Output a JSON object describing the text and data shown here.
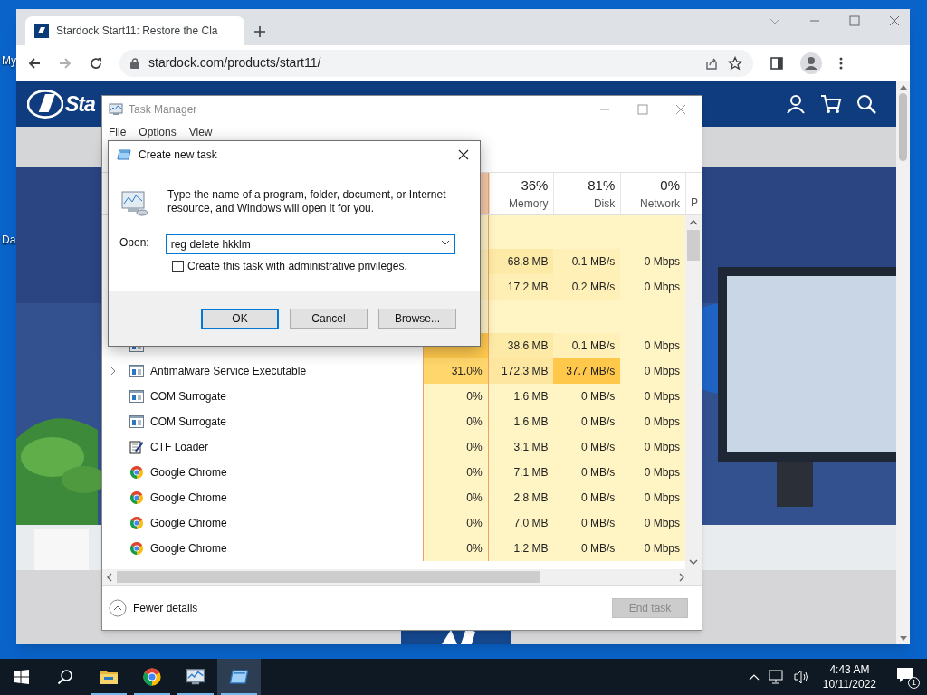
{
  "desktop": {
    "icon_labels": [
      "My",
      "Da"
    ]
  },
  "browser": {
    "tab": {
      "title": "Stardock Start11: Restore the Cla"
    },
    "address": "stardock.com/products/start11/",
    "page": {
      "logo_text": "Sta"
    }
  },
  "task_manager": {
    "title": "Task Manager",
    "menu": [
      "File",
      "Options",
      "View"
    ],
    "columns": [
      {
        "percent": "36%",
        "label": "Memory"
      },
      {
        "percent": "81%",
        "label": "Disk"
      },
      {
        "percent": "0%",
        "label": "Network"
      },
      {
        "label": "P"
      }
    ],
    "rows": [
      {
        "kind": "group"
      },
      {
        "kind": "process",
        "cells": [
          {
            "color": "#fff0b8"
          },
          {
            "text": "68.8 MB",
            "color": "#fdeaa6"
          },
          {
            "text": "0.1 MB/s",
            "color": "#fff0b8"
          },
          {
            "text": "0 Mbps",
            "color": "#fff4c4"
          }
        ]
      },
      {
        "kind": "process",
        "cells": [
          {
            "color": "#fff0b8"
          },
          {
            "text": "17.2 MB",
            "color": "#feefb4"
          },
          {
            "text": "0.2 MB/s",
            "color": "#fff0b8"
          },
          {
            "text": "0 Mbps",
            "color": "#fff4c4"
          }
        ]
      },
      {
        "kind": "group"
      },
      {
        "kind": "service",
        "expandable": false,
        "cells": [
          {
            "color": "#ffc94d"
          },
          {
            "text": "38.6 MB",
            "color": "#fdeaa6"
          },
          {
            "text": "0.1 MB/s",
            "color": "#fff0b8"
          },
          {
            "text": "0 Mbps",
            "color": "#fff4c4"
          }
        ]
      },
      {
        "kind": "service",
        "name": "Antimalware Service Executable",
        "expandable": true,
        "cells": [
          {
            "text": "31.0%",
            "color": "#ffd66b"
          },
          {
            "text": "172.3 MB",
            "color": "#fde6a0"
          },
          {
            "text": "37.7 MB/s",
            "color": "#ffc84a"
          },
          {
            "text": "0 Mbps",
            "color": "#fff4c4"
          }
        ]
      },
      {
        "kind": "service",
        "name": "COM Surrogate",
        "expandable": false,
        "cells": [
          {
            "text": "0%",
            "color": "#fff4c4"
          },
          {
            "text": "1.6 MB",
            "color": "#fff4c4"
          },
          {
            "text": "0 MB/s",
            "color": "#fff4c4"
          },
          {
            "text": "0 Mbps",
            "color": "#fff4c4"
          }
        ]
      },
      {
        "kind": "service",
        "name": "COM Surrogate",
        "expandable": false,
        "cells": [
          {
            "text": "0%",
            "color": "#fff4c4"
          },
          {
            "text": "1.6 MB",
            "color": "#fff4c4"
          },
          {
            "text": "0 MB/s",
            "color": "#fff4c4"
          },
          {
            "text": "0 Mbps",
            "color": "#fff4c4"
          }
        ]
      },
      {
        "kind": "loader",
        "name": "CTF Loader",
        "expandable": false,
        "cells": [
          {
            "text": "0%",
            "color": "#fff4c4"
          },
          {
            "text": "3.1 MB",
            "color": "#fff4c4"
          },
          {
            "text": "0 MB/s",
            "color": "#fff4c4"
          },
          {
            "text": "0 Mbps",
            "color": "#fff4c4"
          }
        ]
      },
      {
        "kind": "browser",
        "name": "Google Chrome",
        "expandable": false,
        "cells": [
          {
            "text": "0%",
            "color": "#fff4c4"
          },
          {
            "text": "7.1 MB",
            "color": "#fff4c4"
          },
          {
            "text": "0 MB/s",
            "color": "#fff4c4"
          },
          {
            "text": "0 Mbps",
            "color": "#fff4c4"
          }
        ]
      },
      {
        "kind": "browser",
        "name": "Google Chrome",
        "expandable": false,
        "cells": [
          {
            "text": "0%",
            "color": "#fff4c4"
          },
          {
            "text": "2.8 MB",
            "color": "#fff4c4"
          },
          {
            "text": "0 MB/s",
            "color": "#fff4c4"
          },
          {
            "text": "0 Mbps",
            "color": "#fff4c4"
          }
        ]
      },
      {
        "kind": "browser",
        "name": "Google Chrome",
        "expandable": false,
        "cells": [
          {
            "text": "0%",
            "color": "#fff4c4"
          },
          {
            "text": "7.0 MB",
            "color": "#fff4c4"
          },
          {
            "text": "0 MB/s",
            "color": "#fff4c4"
          },
          {
            "text": "0 Mbps",
            "color": "#fff4c4"
          }
        ]
      },
      {
        "kind": "browser",
        "name": "Google Chrome",
        "expandable": false,
        "cells": [
          {
            "text": "0%",
            "color": "#fff4c4"
          },
          {
            "text": "1.2 MB",
            "color": "#fff4c4"
          },
          {
            "text": "0 MB/s",
            "color": "#fff4c4"
          },
          {
            "text": "0 Mbps",
            "color": "#fff4c4"
          }
        ]
      }
    ],
    "fewer_details": "Fewer details",
    "end_task": {
      "label": "End task",
      "disabled": true
    }
  },
  "dialog": {
    "title": "Create new task",
    "message": "Type the name of a program, folder, document, or Internet resource, and Windows will open it for you.",
    "open_label": "Open:",
    "value": "reg delete hkklm",
    "admin_checkbox": {
      "label": "Create this task with administrative privileges.",
      "checked": false
    },
    "buttons": [
      {
        "label": "OK",
        "selected": true
      },
      {
        "label": "Cancel",
        "selected": false
      },
      {
        "label": "Browse...",
        "selected": false
      }
    ]
  },
  "taskbar": {
    "items": [
      {
        "kind": "start",
        "open": false,
        "selected": false
      },
      {
        "kind": "search",
        "open": false,
        "selected": false
      },
      {
        "kind": "explorer",
        "open": true,
        "selected": false
      },
      {
        "kind": "chrome",
        "open": true,
        "selected": false
      },
      {
        "kind": "taskmgr",
        "open": true,
        "selected": false
      },
      {
        "kind": "run",
        "open": true,
        "selected": true
      }
    ],
    "time": "4:43 AM",
    "date": "10/11/2022",
    "notifications": "1"
  }
}
